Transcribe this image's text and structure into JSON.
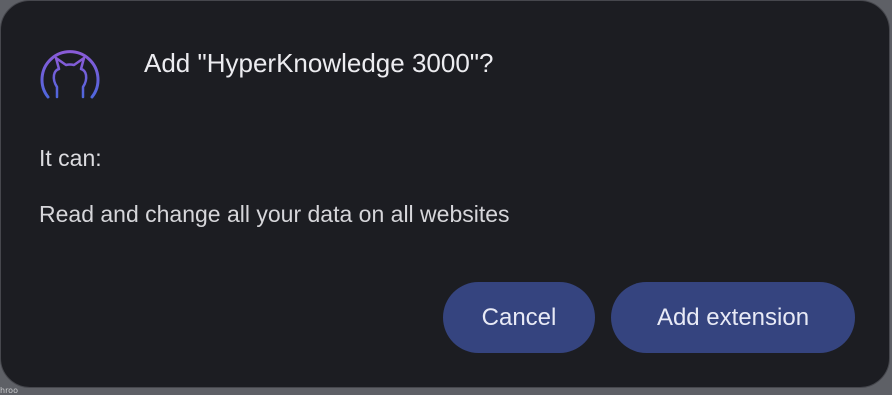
{
  "dialog": {
    "icon": "hooded-cat-extension-icon",
    "title": "Add \"HyperKnowledge 3000\"?",
    "it_can_label": "It can:",
    "permission": "Read and change all your data on all websites",
    "cancel_label": "Cancel",
    "add_label": "Add extension"
  },
  "background": {
    "partial_text": "hroo"
  },
  "colors": {
    "dialog_bg": "#1c1d22",
    "button_bg": "#35447f",
    "icon_gradient_top": "#7f5bd6",
    "icon_gradient_bottom": "#4f63d9"
  }
}
